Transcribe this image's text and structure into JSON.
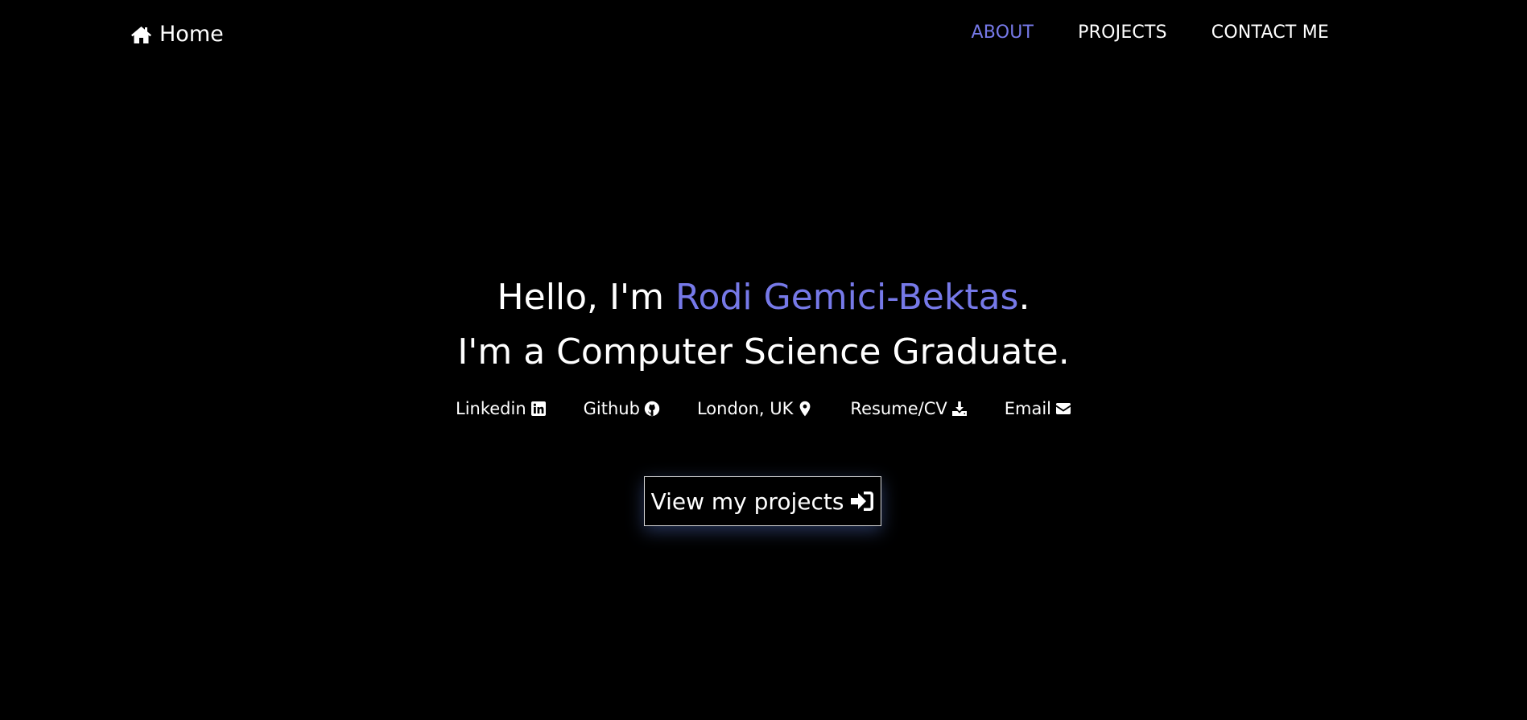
{
  "colors": {
    "background": "#000000",
    "text": "#ffffff",
    "accent": "#7679e8"
  },
  "navbar": {
    "brand": {
      "icon": "home-icon",
      "label": "Home"
    },
    "links": [
      {
        "label": "ABOUT",
        "active": true
      },
      {
        "label": "PROJECTS",
        "active": false
      },
      {
        "label": "CONTACT ME",
        "active": false
      }
    ]
  },
  "hero": {
    "greeting_prefix": "Hello, I'm ",
    "name": "Rodi Gemici-Bektas",
    "greeting_suffix": ".",
    "tagline": "I'm a Computer Science Graduate."
  },
  "contacts": [
    {
      "label": "Linkedin",
      "icon": "linkedin-icon"
    },
    {
      "label": "Github",
      "icon": "github-icon"
    },
    {
      "label": "London, UK",
      "icon": "map-marker-icon"
    },
    {
      "label": "Resume/CV",
      "icon": "download-icon"
    },
    {
      "label": "Email",
      "icon": "envelope-icon"
    }
  ],
  "cta": {
    "label": "View my projects",
    "icon": "sign-in-icon"
  }
}
